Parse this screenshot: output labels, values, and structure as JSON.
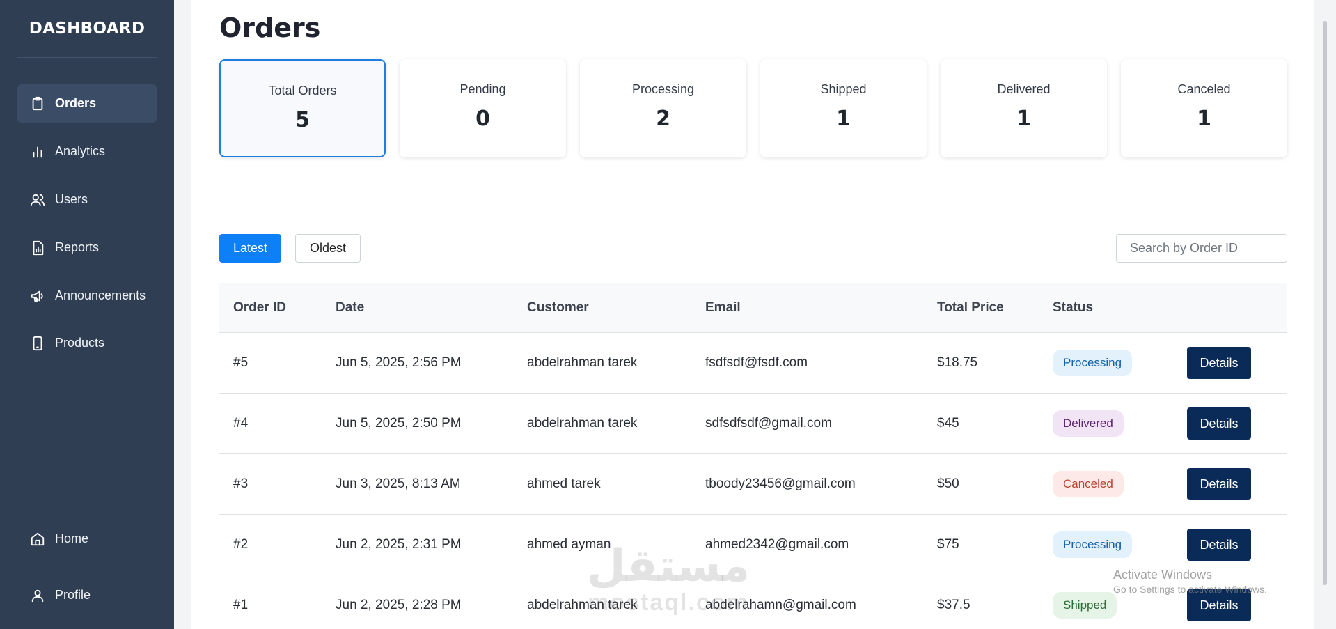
{
  "sidebar": {
    "brand": "DASHBOARD",
    "items": [
      {
        "label": "Orders",
        "icon": "clipboard-icon",
        "active": true
      },
      {
        "label": "Analytics",
        "icon": "bar-chart-icon"
      },
      {
        "label": "Users",
        "icon": "users-icon"
      },
      {
        "label": "Reports",
        "icon": "report-icon"
      },
      {
        "label": "Announcements",
        "icon": "megaphone-icon"
      },
      {
        "label": "Products",
        "icon": "phone-icon"
      }
    ],
    "bottom": [
      {
        "label": "Home",
        "icon": "home-icon"
      },
      {
        "label": "Profile",
        "icon": "user-icon"
      }
    ]
  },
  "page": {
    "title": "Orders"
  },
  "stats": [
    {
      "label": "Total Orders",
      "value": "5",
      "active": true
    },
    {
      "label": "Pending",
      "value": "0"
    },
    {
      "label": "Processing",
      "value": "2"
    },
    {
      "label": "Shipped",
      "value": "1"
    },
    {
      "label": "Delivered",
      "value": "1"
    },
    {
      "label": "Canceled",
      "value": "1"
    }
  ],
  "sort": {
    "latest": "Latest",
    "oldest": "Oldest",
    "selected": "Latest"
  },
  "search": {
    "placeholder": "Search by Order ID"
  },
  "table": {
    "headers": [
      "Order ID",
      "Date",
      "Customer",
      "Email",
      "Total Price",
      "Status"
    ],
    "rows": [
      {
        "id": "#5",
        "date": "Jun 5, 2025, 2:56 PM",
        "customer": "abdelrahman tarek",
        "email": "fsdfsdf@fsdf.com",
        "price": "$18.75",
        "status": "Processing",
        "action": "Details"
      },
      {
        "id": "#4",
        "date": "Jun 5, 2025, 2:50 PM",
        "customer": "abdelrahman tarek",
        "email": "sdfsdfsdf@gmail.com",
        "price": "$45",
        "status": "Delivered",
        "action": "Details"
      },
      {
        "id": "#3",
        "date": "Jun 3, 2025, 8:13 AM",
        "customer": "ahmed tarek",
        "email": "tboody23456@gmail.com",
        "price": "$50",
        "status": "Canceled",
        "action": "Details"
      },
      {
        "id": "#2",
        "date": "Jun 2, 2025, 2:31 PM",
        "customer": "ahmed ayman",
        "email": "ahmed2342@gmail.com",
        "price": "$75",
        "status": "Processing",
        "action": "Details"
      },
      {
        "id": "#1",
        "date": "Jun 2, 2025, 2:28 PM",
        "customer": "abdelrahman tarek",
        "email": "abdelrahamn@gmail.com",
        "price": "$37.5",
        "status": "Shipped",
        "action": "Details"
      }
    ]
  },
  "status_colors": {
    "Processing": {
      "bg": "#e3f1fc",
      "fg": "#1561a8"
    },
    "Delivered": {
      "bg": "#f1e4f5",
      "fg": "#5c2270"
    },
    "Canceled": {
      "bg": "#fde9e7",
      "fg": "#b8422e"
    },
    "Shipped": {
      "bg": "#e6f4e8",
      "fg": "#2b6b36"
    }
  },
  "colors": {
    "sidebar": "#2f3e52",
    "accent": "#0d7ff7",
    "details_button": "#0a2a57"
  },
  "watermark": {
    "activate_title": "Activate Windows",
    "activate_sub": "Go to Settings to activate Windows.",
    "logo_text": "mostaql.com",
    "logo_text_ar": "مستقل"
  }
}
